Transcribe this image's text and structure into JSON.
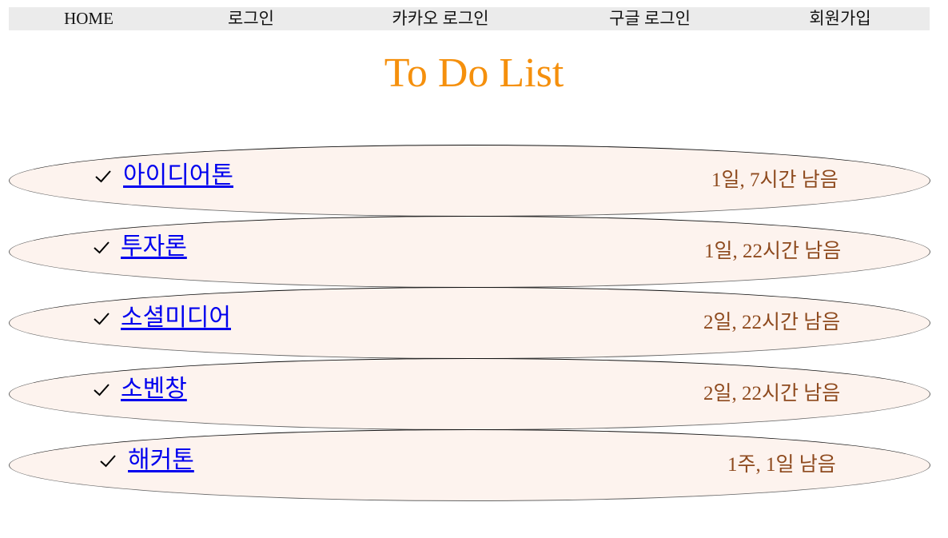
{
  "nav": {
    "items": [
      {
        "label": "HOME"
      },
      {
        "label": "로그인"
      },
      {
        "label": "카카오 로그인"
      },
      {
        "label": "구글 로그인"
      },
      {
        "label": "회원가입"
      }
    ]
  },
  "page": {
    "title": "To Do List"
  },
  "todos": [
    {
      "title": "아이디어톤",
      "remaining": "1일, 7시간 남음"
    },
    {
      "title": "투자론",
      "remaining": "1일, 22시간 남음"
    },
    {
      "title": "소셜미디어",
      "remaining": "2일, 22시간 남음"
    },
    {
      "title": "소벤창",
      "remaining": "2일, 22시간 남음"
    },
    {
      "title": "해커톤",
      "remaining": "1주, 1일 남음"
    }
  ],
  "icons": {
    "check": "check-icon"
  },
  "colors": {
    "title": "#f5900d",
    "item_background": "#fdf3ee",
    "link": "#0000ee",
    "remaining": "#8e4a1e",
    "nav_background": "#ebebeb"
  }
}
